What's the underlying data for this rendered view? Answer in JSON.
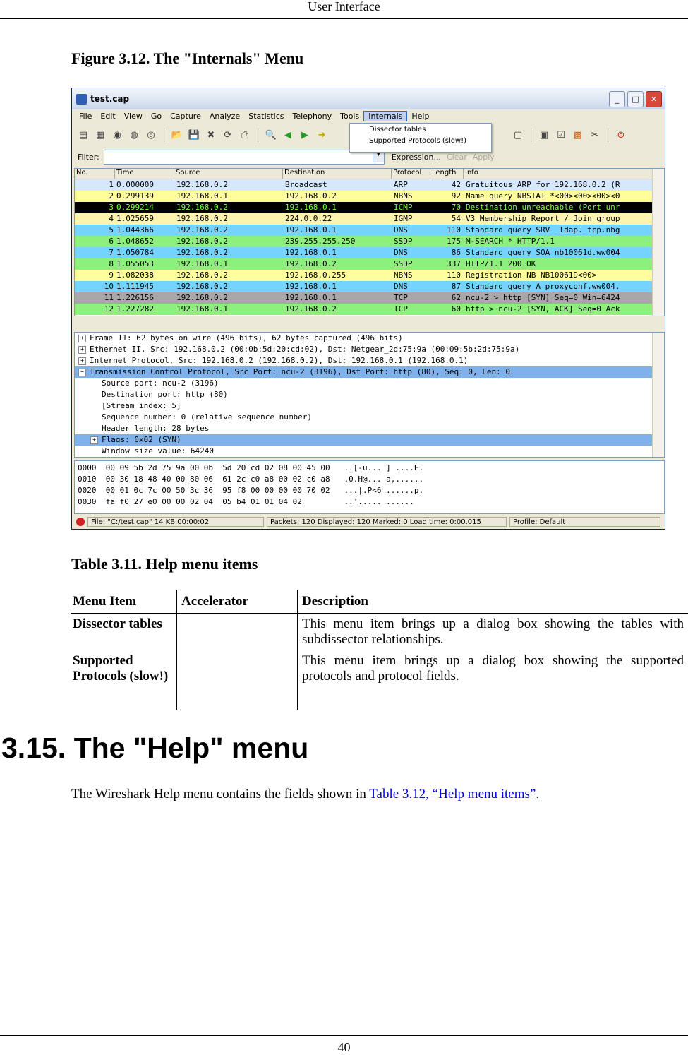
{
  "page": {
    "header": "User Interface",
    "footer": "40",
    "figure_title": "Figure 3.12. The \"Internals\" Menu",
    "table_title": "Table 3.11. Help menu items",
    "section_title": "3.15. The \"Help\" menu",
    "body_prefix": "The Wireshark Help menu contains the fields shown in ",
    "body_link": "Table 3.12, “Help menu items”",
    "body_suffix": "."
  },
  "table": {
    "headers": [
      "Menu Item",
      "Accelerator",
      "Description"
    ],
    "rows": [
      {
        "item": "Dissector tables",
        "accelerator": "",
        "description": "This menu item brings up a dialog box showing the tables with subdissector relationships."
      },
      {
        "item": "Supported Protocols (slow!)",
        "accelerator": "",
        "description": "This menu item brings up a dialog box showing the supported protocols and protocol fields."
      }
    ]
  },
  "window": {
    "title": "test.cap",
    "menu": [
      "File",
      "Edit",
      "View",
      "Go",
      "Capture",
      "Analyze",
      "Statistics",
      "Telephony",
      "Tools",
      "Internals",
      "Help"
    ],
    "dropdown": [
      "Dissector tables",
      "Supported Protocols (slow!)"
    ],
    "filter_label": "Filter:",
    "filter_expression": "Expression...",
    "filter_clear": "Clear",
    "filter_apply": "Apply",
    "columns": [
      "No.",
      "Time",
      "Source",
      "Destination",
      "Protocol",
      "Length",
      "Info"
    ],
    "packets": [
      {
        "no": "1",
        "time": "0.000000",
        "src": "192.168.0.2",
        "dst": "Broadcast",
        "proto": "ARP",
        "len": "42",
        "info": "Gratuitous ARP for 192.168.0.2 (R",
        "bg": "#d6e8ff",
        "fg": "#000000"
      },
      {
        "no": "2",
        "time": "0.299139",
        "src": "192.168.0.1",
        "dst": "192.168.0.2",
        "proto": "NBNS",
        "len": "92",
        "info": "Name query NBSTAT *<00><00><00><0",
        "bg": "#fffd9c",
        "fg": "#000000"
      },
      {
        "no": "3",
        "time": "0.299214",
        "src": "192.168.0.2",
        "dst": "192.168.0.1",
        "proto": "ICMP",
        "len": "70",
        "info": "Destination unreachable (Port unr",
        "bg": "#000000",
        "fg": "#7cff3f"
      },
      {
        "no": "4",
        "time": "1.025659",
        "src": "192.168.0.2",
        "dst": "224.0.0.22",
        "proto": "IGMP",
        "len": "54",
        "info": "V3 Membership Report / Join group",
        "bg": "#fff3b0",
        "fg": "#000000"
      },
      {
        "no": "5",
        "time": "1.044366",
        "src": "192.168.0.2",
        "dst": "192.168.0.1",
        "proto": "DNS",
        "len": "110",
        "info": "Standard query SRV _ldap._tcp.nbg",
        "bg": "#74d4ff",
        "fg": "#000000"
      },
      {
        "no": "6",
        "time": "1.048652",
        "src": "192.168.0.2",
        "dst": "239.255.255.250",
        "proto": "SSDP",
        "len": "175",
        "info": "M-SEARCH * HTTP/1.1",
        "bg": "#8ef07c",
        "fg": "#000000"
      },
      {
        "no": "7",
        "time": "1.050784",
        "src": "192.168.0.2",
        "dst": "192.168.0.1",
        "proto": "DNS",
        "len": "86",
        "info": "Standard query SOA nb10061d.ww004",
        "bg": "#74d4ff",
        "fg": "#000000"
      },
      {
        "no": "8",
        "time": "1.055053",
        "src": "192.168.0.1",
        "dst": "192.168.0.2",
        "proto": "SSDP",
        "len": "337",
        "info": "HTTP/1.1 200 OK",
        "bg": "#8ef07c",
        "fg": "#000000"
      },
      {
        "no": "9",
        "time": "1.082038",
        "src": "192.168.0.2",
        "dst": "192.168.0.255",
        "proto": "NBNS",
        "len": "110",
        "info": "Registration NB NB10061D<00>",
        "bg": "#fffd9c",
        "fg": "#000000"
      },
      {
        "no": "10",
        "time": "1.111945",
        "src": "192.168.0.2",
        "dst": "192.168.0.1",
        "proto": "DNS",
        "len": "87",
        "info": "Standard query A proxyconf.ww004.",
        "bg": "#74d4ff",
        "fg": "#000000"
      },
      {
        "no": "11",
        "time": "1.226156",
        "src": "192.168.0.2",
        "dst": "192.168.0.1",
        "proto": "TCP",
        "len": "62",
        "info": "ncu-2 > http [SYN] Seq=0 Win=6424",
        "bg": "#a8a8a8",
        "fg": "#000000"
      },
      {
        "no": "12",
        "time": "1.227282",
        "src": "192.168.0.1",
        "dst": "192.168.0.2",
        "proto": "TCP",
        "len": "60",
        "info": "http > ncu-2 [SYN, ACK] Seq=0 Ack",
        "bg": "#8ef07c",
        "fg": "#000000"
      }
    ],
    "details": [
      {
        "text": "Frame 11: 62 bytes on wire (496 bits), 62 bytes captured (496 bits)",
        "exp": "+",
        "level": "lvl0",
        "sel": false
      },
      {
        "text": "Ethernet II, Src: 192.168.0.2 (00:0b:5d:20:cd:02), Dst: Netgear_2d:75:9a (00:09:5b:2d:75:9a)",
        "exp": "+",
        "level": "lvl0",
        "sel": false
      },
      {
        "text": "Internet Protocol, Src: 192.168.0.2 (192.168.0.2), Dst: 192.168.0.1 (192.168.0.1)",
        "exp": "+",
        "level": "lvl0",
        "sel": false
      },
      {
        "text": "Transmission Control Protocol, Src Port: ncu-2 (3196), Dst Port: http (80), Seq: 0, Len: 0",
        "exp": "−",
        "level": "lvl0",
        "sel": true
      },
      {
        "text": "Source port: ncu-2 (3196)",
        "exp": "",
        "level": "lvl1",
        "sel": false
      },
      {
        "text": "Destination port: http (80)",
        "exp": "",
        "level": "lvl1",
        "sel": false
      },
      {
        "text": "[Stream index: 5]",
        "exp": "",
        "level": "lvl1",
        "sel": false
      },
      {
        "text": "Sequence number: 0    (relative sequence number)",
        "exp": "",
        "level": "lvl1",
        "sel": false
      },
      {
        "text": "Header length: 28 bytes",
        "exp": "",
        "level": "lvl1",
        "sel": false
      },
      {
        "text": "Flags: 0x02 (SYN)",
        "exp": "+",
        "level": "lvl1x",
        "sel": true
      },
      {
        "text": "Window size value: 64240",
        "exp": "",
        "level": "lvl1",
        "sel": false
      }
    ],
    "hex": [
      "0000  00 09 5b 2d 75 9a 00 0b  5d 20 cd 02 08 00 45 00   ..[-u... ] ....E.",
      "0010  00 30 18 48 40 00 80 06  61 2c c0 a8 00 02 c0 a8   .0.H@... a,......",
      "0020  00 01 0c 7c 00 50 3c 36  95 f8 00 00 00 00 70 02   ...|.P<6 ......p.",
      "0030  fa f0 27 e0 00 00 02 04  05 b4 01 01 04 02         ..'..... ......"
    ],
    "status": {
      "file": "File: \"C:/test.cap\" 14 KB 00:00:02",
      "packets": "Packets: 120 Displayed: 120 Marked: 0 Load time: 0:00.015",
      "profile": "Profile: Default"
    }
  }
}
